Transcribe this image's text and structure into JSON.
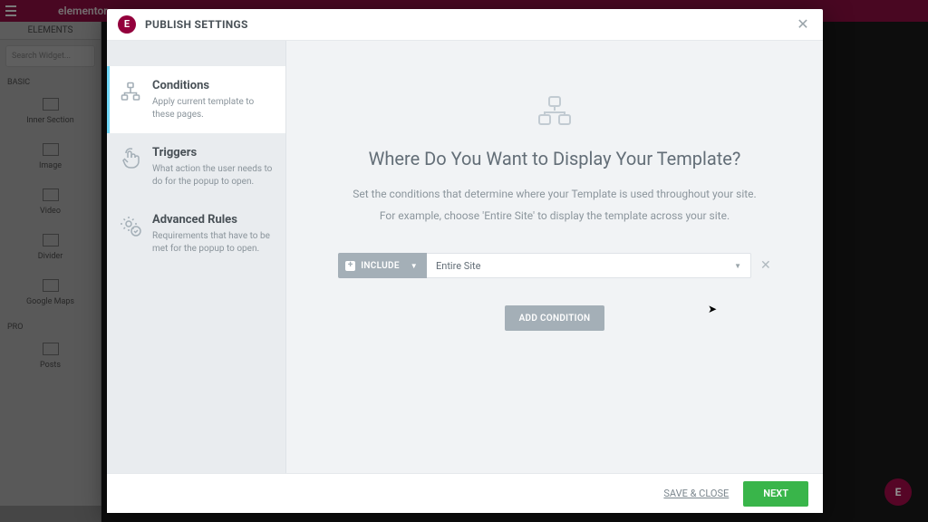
{
  "background_editor": {
    "brand": "elementor",
    "tab_label": "ELEMENTS",
    "search_placeholder": "Search Widget...",
    "section_basic": "BASIC",
    "section_pro": "PRO",
    "widgets_basic": [
      "Inner Section",
      "Image",
      "Video",
      "Divider",
      "Google Maps"
    ],
    "widgets_pro": [
      "Posts"
    ]
  },
  "modal": {
    "title": "PUBLISH SETTINGS",
    "sidebar": [
      {
        "title": "Conditions",
        "desc": "Apply current template to these pages."
      },
      {
        "title": "Triggers",
        "desc": "What action the user needs to do for the popup to open."
      },
      {
        "title": "Advanced Rules",
        "desc": "Requirements that have to be met for the popup to open."
      }
    ],
    "main": {
      "heading": "Where Do You Want to Display Your Template?",
      "sub1": "Set the conditions that determine where your Template is used throughout your site.",
      "sub2": "For example, choose 'Entire Site' to display the template across your site.",
      "condition_include_label": "INCLUDE",
      "condition_value": "Entire Site",
      "add_condition_label": "ADD CONDITION"
    },
    "footer": {
      "save_close": "SAVE & CLOSE",
      "next": "NEXT"
    }
  }
}
